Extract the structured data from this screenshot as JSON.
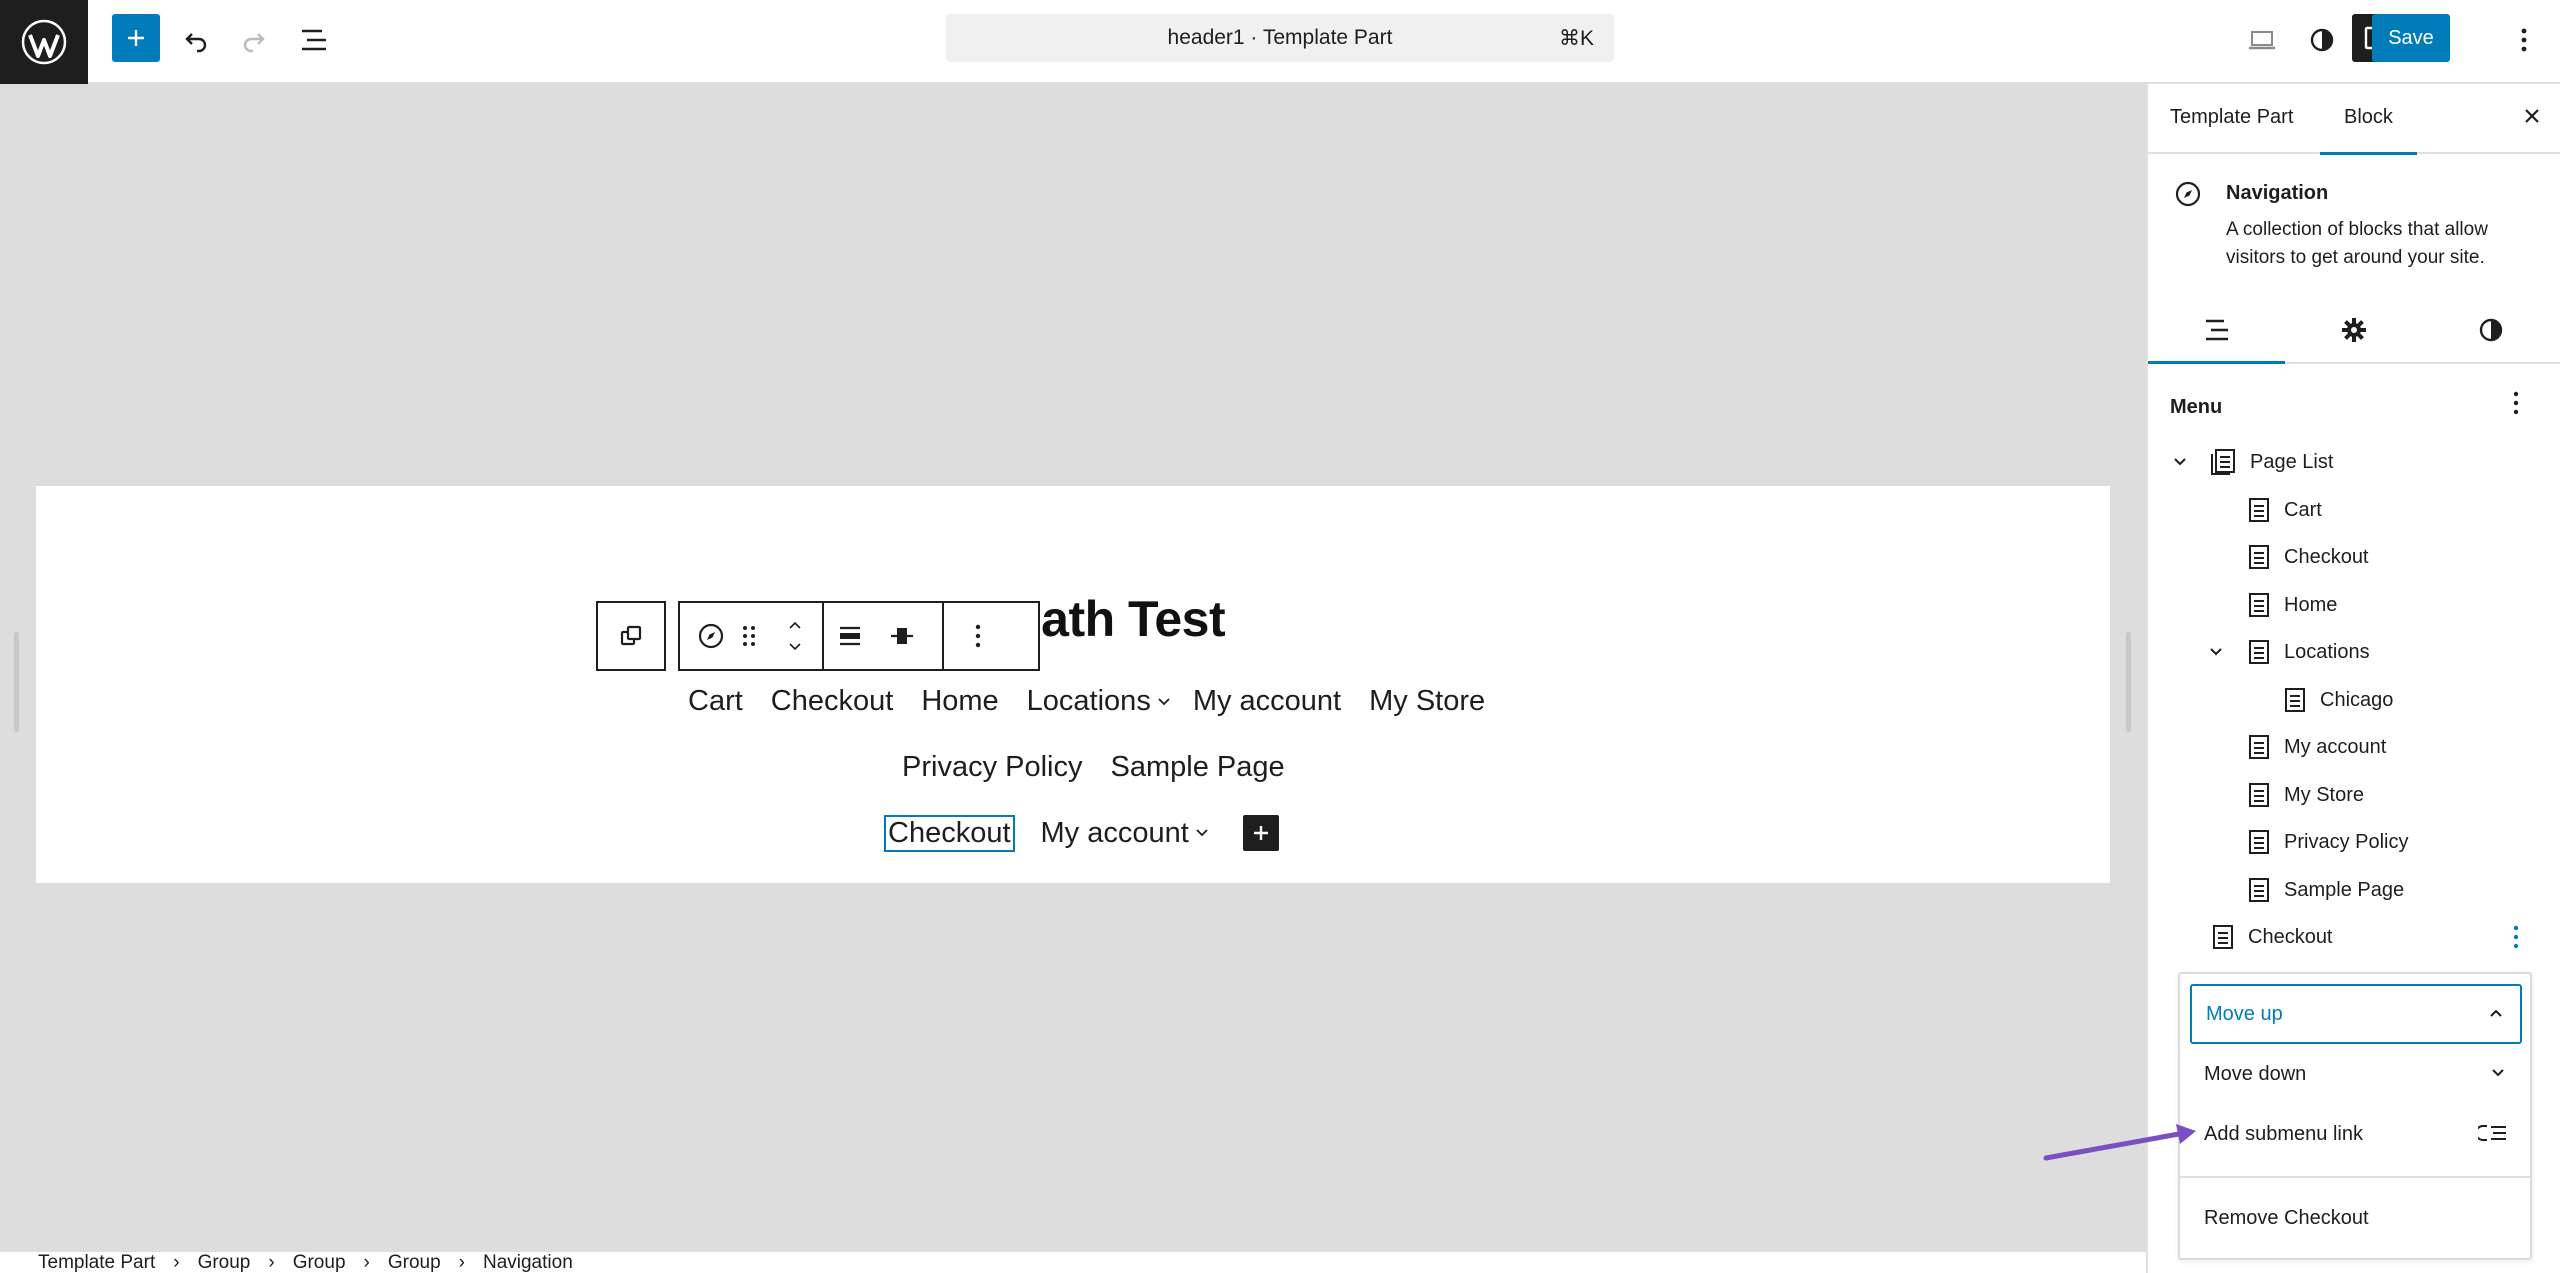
{
  "topbar": {
    "document_title": "header1 · Template Part",
    "shortcut": "⌘K",
    "save_label": "Save"
  },
  "canvas": {
    "site_title": "Math Test",
    "nav_row_1": [
      "Cart",
      "Checkout",
      "Home",
      "Locations",
      "My account",
      "My Store"
    ],
    "nav_row_2": [
      "Privacy Policy",
      "Sample Page"
    ],
    "nav_row_3": [
      "Checkout",
      "My account"
    ]
  },
  "breadcrumb": [
    "Template Part",
    "Group",
    "Group",
    "Group",
    "Navigation"
  ],
  "sidebar": {
    "tabs": [
      "Template Part",
      "Block"
    ],
    "block_title": "Navigation",
    "block_description": "A collection of blocks that allow visitors to get around your site.",
    "menu_heading": "Menu",
    "tree": [
      {
        "label": "Page List"
      },
      {
        "label": "Cart"
      },
      {
        "label": "Checkout"
      },
      {
        "label": "Home"
      },
      {
        "label": "Locations"
      },
      {
        "label": "Chicago"
      },
      {
        "label": "My account"
      },
      {
        "label": "My Store"
      },
      {
        "label": "Privacy Policy"
      },
      {
        "label": "Sample Page"
      },
      {
        "label": "Checkout"
      }
    ]
  },
  "dropdown": {
    "move_up": "Move up",
    "move_down": "Move down",
    "add_submenu": "Add submenu link",
    "remove": "Remove Checkout"
  },
  "colors": {
    "accent": "#007cba",
    "annotation_arrow": "#7b4fc1"
  }
}
